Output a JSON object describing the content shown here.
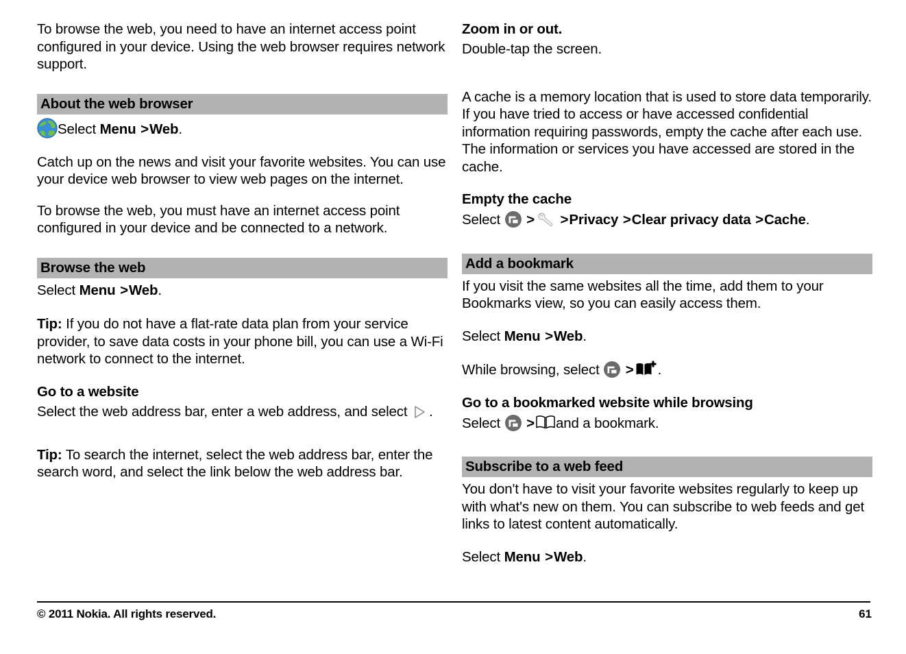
{
  "document": {
    "page_number": "61",
    "copyright": "© 2011 Nokia. All rights reserved."
  },
  "left_column": {
    "intro_paragraph": "To browse the web, you need to have an internet access point configured in your device. Using the web browser requires network support.",
    "section_about": {
      "heading": "About the web browser",
      "select_prefix": "Select ",
      "menu_label": "Menu",
      "separator": ">",
      "web_label": "Web",
      "period": ".",
      "paragraph_1": "Catch up on the news and visit your favorite websites. You can use your device web browser to view web pages on the internet.",
      "paragraph_2": "To browse the web, you must have an internet access point configured in your device and be connected to a network."
    },
    "section_browse": {
      "heading": "Browse the web",
      "select_prefix": "Select ",
      "menu_label": "Menu",
      "separator": ">",
      "web_label": "Web",
      "period": ".",
      "tip_label": "Tip:",
      "tip_text": " If you do not have a flat-rate data plan from your service provider, to save data costs in your phone bill, you can use a Wi-Fi network to connect to the internet.",
      "subhead_goto": "Go to a website",
      "goto_text": "Select the web address bar, enter a web address, and select ",
      "goto_period": ".",
      "tip2_label": "Tip:",
      "tip2_text": " To search the internet, select the web address bar, enter the search word, and select the link below the web address bar."
    }
  },
  "right_column": {
    "zoom_block": {
      "subhead": "Zoom in or out.",
      "text": "Double-tap the screen."
    },
    "cache_paragraph": "A cache is a memory location that is used to store data temporarily. If you have tried to access or have accessed confidential information requiring passwords, empty the cache after each use. The information or services you have accessed are stored in the cache.",
    "empty_cache": {
      "subhead": "Empty the cache",
      "select_prefix": "Select ",
      "sep1": ">",
      "sep2": ">",
      "privacy_label": "Privacy",
      "sep3": ">",
      "clear_privacy_label": "Clear privacy data",
      "sep4": ">",
      "cache_label": "Cache",
      "period": "."
    },
    "section_bookmark": {
      "heading": "Add a bookmark",
      "paragraph": "If you visit the same websites all the time, add them to your Bookmarks view, so you can easily access them.",
      "select_prefix": "Select ",
      "menu_label": "Menu",
      "separator": ">",
      "web_label": "Web",
      "period": ".",
      "while_browsing_text": "While browsing, select ",
      "while_browsing_sep": ">",
      "while_browsing_period": ".",
      "subhead_goto_bookmarked": "Go to a bookmarked website while browsing",
      "goto_select_prefix": "Select ",
      "goto_sep": ">",
      "goto_suffix": "and a bookmark."
    },
    "section_feed": {
      "heading": "Subscribe to a web feed",
      "paragraph": "You don't have to visit your favorite websites regularly to keep up with what's new on them. You can subscribe to web feeds and get links to latest content automatically.",
      "select_prefix": "Select ",
      "menu_label": "Menu",
      "separator": ">",
      "web_label": "Web",
      "period": "."
    }
  },
  "icons": {
    "globe": "globe-icon",
    "menu_options": "options-menu-icon",
    "wrench": "wrench-settings-icon",
    "book": "bookmarks-book-icon",
    "book_add": "add-bookmark-icon",
    "play": "go-play-icon"
  },
  "colors": {
    "section_bar": "#b2b2b2",
    "text": "#000000",
    "icon_gray": "#666666",
    "globe_ocean": "#3b8fd4",
    "globe_land": "#6fc04a"
  }
}
